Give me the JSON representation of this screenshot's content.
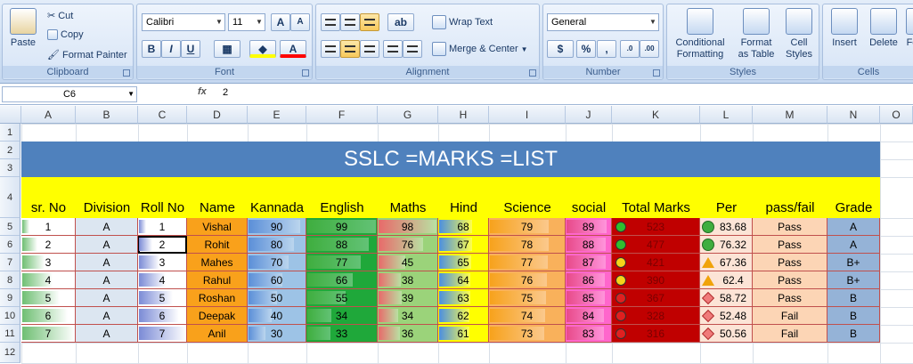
{
  "ribbon": {
    "clipboard": {
      "paste": "Paste",
      "cut": "Cut",
      "copy": "Copy",
      "format_painter": "Format Painter",
      "label": "Clipboard"
    },
    "font": {
      "name": "Calibri",
      "size": "11",
      "label": "Font",
      "bold": "B",
      "italic": "I",
      "underline": "U",
      "grow": "A",
      "shrink": "A"
    },
    "alignment": {
      "wrap": "Wrap Text",
      "merge": "Merge & Center",
      "label": "Alignment"
    },
    "number": {
      "format": "General",
      "label": "Number",
      "currency": "$",
      "percent": "%",
      "comma": ","
    },
    "styles": {
      "cond": "Conditional",
      "cond2": "Formatting",
      "fmt": "Format",
      "fmt2": "as Table",
      "cell": "Cell",
      "cell2": "Styles",
      "label": "Styles"
    },
    "cells": {
      "insert": "Insert",
      "delete": "Delete",
      "format": "Fo",
      "label": "Cells"
    }
  },
  "formula_bar": {
    "name_box": "C6",
    "fx": "fx",
    "value": "2"
  },
  "columns": [
    "A",
    "B",
    "C",
    "D",
    "E",
    "F",
    "G",
    "H",
    "I",
    "J",
    "K",
    "L",
    "M",
    "N",
    "O"
  ],
  "rows": [
    "1",
    "2",
    "3",
    "4",
    "5",
    "6",
    "7",
    "8",
    "9",
    "10",
    "11",
    "12"
  ],
  "title": "SSLC =MARKS =LIST",
  "headers": [
    "sr. No",
    "Division",
    "Roll No",
    "Name",
    "Kannada",
    "English",
    "Maths",
    "Hind",
    "Science",
    "social",
    "Total Marks",
    "Per",
    "pass/fail",
    "Grade"
  ],
  "students": [
    {
      "sr": "1",
      "div": "A",
      "roll": "1",
      "name": "Vishal",
      "kan": "90",
      "eng": "99",
      "mat": "98",
      "hin": "68",
      "sci": "79",
      "soc": "89",
      "tot": "523",
      "per": "83.68",
      "pf": "Pass",
      "gr": "A",
      "light": "green",
      "icon": "circle"
    },
    {
      "sr": "2",
      "div": "A",
      "roll": "2",
      "name": "Rohit",
      "kan": "80",
      "eng": "88",
      "mat": "76",
      "hin": "67",
      "sci": "78",
      "soc": "88",
      "tot": "477",
      "per": "76.32",
      "pf": "Pass",
      "gr": "A",
      "light": "green",
      "icon": "circle"
    },
    {
      "sr": "3",
      "div": "A",
      "roll": "3",
      "name": "Mahes",
      "kan": "70",
      "eng": "77",
      "mat": "45",
      "hin": "65",
      "sci": "77",
      "soc": "87",
      "tot": "421",
      "per": "67.36",
      "pf": "Pass",
      "gr": "B+",
      "light": "yellow",
      "icon": "triangle"
    },
    {
      "sr": "4",
      "div": "A",
      "roll": "4",
      "name": "Rahul",
      "kan": "60",
      "eng": "66",
      "mat": "38",
      "hin": "64",
      "sci": "76",
      "soc": "86",
      "tot": "390",
      "per": "62.4",
      "pf": "Pass",
      "gr": "B+",
      "light": "yellow",
      "icon": "triangle"
    },
    {
      "sr": "5",
      "div": "A",
      "roll": "5",
      "name": "Roshan",
      "kan": "50",
      "eng": "55",
      "mat": "39",
      "hin": "63",
      "sci": "75",
      "soc": "85",
      "tot": "367",
      "per": "58.72",
      "pf": "Pass",
      "gr": "B",
      "light": "red",
      "icon": "diamond"
    },
    {
      "sr": "6",
      "div": "A",
      "roll": "6",
      "name": "Deepak",
      "kan": "40",
      "eng": "34",
      "mat": "34",
      "hin": "62",
      "sci": "74",
      "soc": "84",
      "tot": "328",
      "per": "52.48",
      "pf": "Fail",
      "gr": "B",
      "light": "red",
      "icon": "diamond"
    },
    {
      "sr": "7",
      "div": "A",
      "roll": "7",
      "name": "Anil",
      "kan": "30",
      "eng": "33",
      "mat": "36",
      "hin": "61",
      "sci": "73",
      "soc": "83",
      "tot": "316",
      "per": "50.56",
      "pf": "Fail",
      "gr": "B",
      "light": "red",
      "icon": "diamond"
    }
  ],
  "colors": {
    "title_bg": "#4f81bd",
    "header_bg": "#ffff00",
    "name_bg": "#f9a11b",
    "total_bg": "#c00000",
    "pass_bg": "#fcd5b5",
    "grade_bg": "#95b3d7",
    "division_bg": "#dce6f1"
  }
}
